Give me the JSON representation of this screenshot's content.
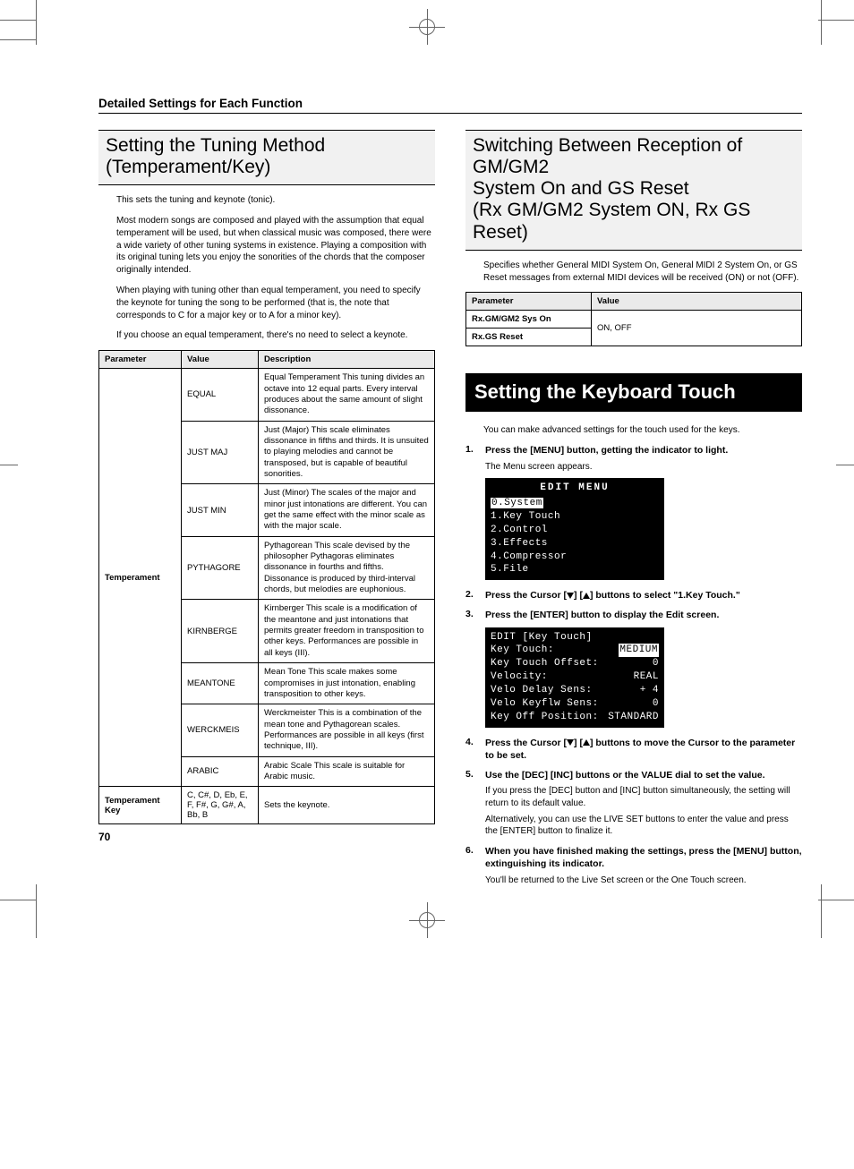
{
  "running_head": "Detailed Settings for Each Function",
  "page_number": "70",
  "left": {
    "title_l1": "Setting the Tuning Method",
    "title_l2": "(Temperament/Key)",
    "p1": "This sets the tuning and keynote (tonic).",
    "p2": "Most modern songs are composed and played with the assumption that equal temperament will be used, but when classical music was composed, there were a wide variety of other tuning systems in existence. Playing a composition with its original tuning lets you enjoy the sonorities of the chords that the composer originally intended.",
    "p3": "When playing with tuning other than equal temperament, you need to specify the keynote for tuning the song to be performed (that is, the note that corresponds to C for a major key or to A for a minor key).",
    "p4": "If you choose an equal temperament, there's no need to select a keynote.",
    "table": {
      "head": {
        "parameter": "Parameter",
        "value": "Value",
        "description": "Description"
      },
      "temperament_label": "Temperament",
      "rows": [
        {
          "value": "EQUAL",
          "desc": "Equal Temperament\nThis tuning divides an octave into 12 equal parts. Every interval produces about the same amount of slight dissonance."
        },
        {
          "value": "JUST MAJ",
          "desc": "Just (Major)\nThis scale eliminates dissonance in fifths and thirds. It is unsuited to playing melodies and cannot be transposed, but is capable of beautiful sonorities."
        },
        {
          "value": "JUST MIN",
          "desc": "Just (Minor)\nThe scales of the major and minor just intonations are different. You can get the same effect with the minor scale as with the major scale."
        },
        {
          "value": "PYTHAGORE",
          "desc": "Pythagorean\nThis scale devised by the philosopher Pythagoras eliminates dissonance in fourths and fifths. Dissonance is produced by third-interval chords, but melodies are euphonious."
        },
        {
          "value": "KIRNBERGE",
          "desc": "Kirnberger\nThis scale is a modification of the meantone and just intonations that permits greater freedom in transposition to other keys. Performances are possible in all keys (III)."
        },
        {
          "value": "MEANTONE",
          "desc": "Mean Tone\nThis scale makes some compromises in just intonation, enabling transposition to other keys."
        },
        {
          "value": "WERCKMEIS",
          "desc": "Werckmeister\nThis is a combination of the mean tone and Pythagorean scales. Performances are possible in all keys (first technique, III)."
        },
        {
          "value": "ARABIC",
          "desc": "Arabic Scale\nThis scale is suitable for Arabic music."
        }
      ],
      "key_row": {
        "param": "Temperament Key",
        "value": "C, C#, D, Eb, E, F, F#, G, G#, A, Bb, B",
        "desc": "Sets the keynote."
      }
    }
  },
  "right": {
    "title_l1": "Switching Between Reception of GM/GM2",
    "title_l2": "System On and GS Reset",
    "title_l3": "(Rx GM/GM2 System ON, Rx GS Reset)",
    "p1": "Specifies whether General MIDI System On, General MIDI 2 System On, or GS Reset messages from external MIDI devices will be received (ON) or not (OFF).",
    "table": {
      "head": {
        "parameter": "Parameter",
        "value": "Value"
      },
      "rows": [
        {
          "param": "Rx.GM/GM2 Sys On"
        },
        {
          "param": "Rx.GS Reset"
        }
      ],
      "shared_value": "ON, OFF"
    },
    "reverse_title": "Setting the Keyboard Touch",
    "p2": "You can make advanced settings for the touch used for the keys.",
    "steps": {
      "s1_lead": "Press the [MENU] button, getting the indicator to light.",
      "s1_sub": "The Menu screen appears.",
      "s2_lead_a": "Press the Cursor [",
      "s2_lead_b": "] [",
      "s2_lead_c": "] buttons to select \"1.Key Touch.\"",
      "s3_lead": "Press the [ENTER] button to display the Edit screen.",
      "s4_lead_a": "Press the Cursor [",
      "s4_lead_b": "] [",
      "s4_lead_c": "] buttons to move the Cursor to the parameter to be set.",
      "s5_lead": "Use the [DEC] [INC] buttons or the VALUE dial to set the value.",
      "s5_p1": "If you press the [DEC] button and [INC] button simultaneously, the setting will return to its default value.",
      "s5_p2": "Alternatively, you can use the LIVE SET buttons to enter the value and press the [ENTER] button to finalize it.",
      "s6_lead": "When you have finished making the settings, press the [MENU] button, extinguishing its indicator.",
      "s6_p1": "You'll be returned to the Live Set screen or the One Touch screen."
    },
    "lcd1": {
      "title": "EDIT MENU",
      "items": [
        "0.System",
        "1.Key Touch",
        "2.Control",
        "3.Effects",
        "4.Compressor",
        "5.File"
      ]
    },
    "lcd2": {
      "title": "EDIT [Key Touch]",
      "rows": [
        {
          "k": "Key Touch:",
          "v": "MEDIUM",
          "sel": true
        },
        {
          "k": "Key Touch Offset:",
          "v": "0"
        },
        {
          "k": "Velocity:",
          "v": "REAL"
        },
        {
          "k": "Velo Delay Sens:",
          "v": "+ 4"
        },
        {
          "k": "Velo Keyflw Sens:",
          "v": "0"
        },
        {
          "k": "Key Off Position:",
          "v": "STANDARD"
        }
      ]
    }
  }
}
